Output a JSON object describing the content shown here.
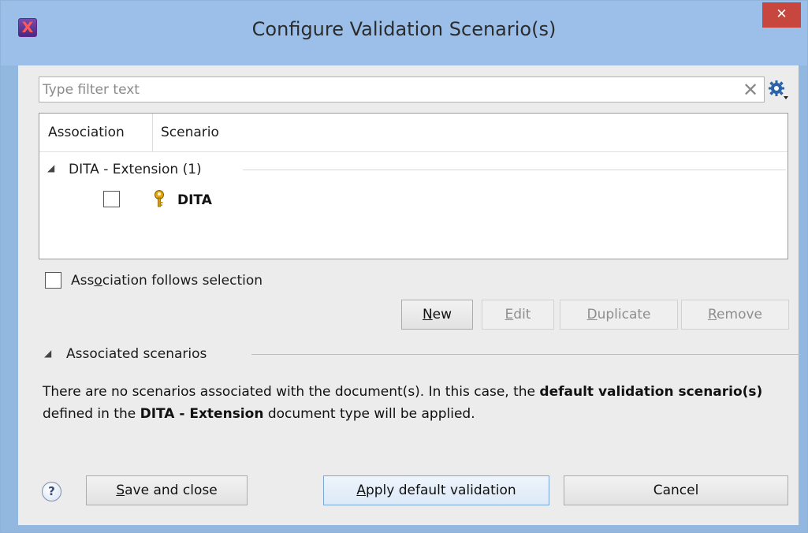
{
  "window": {
    "title": "Configure Validation Scenario(s)",
    "app_icon": "oxygen-x-icon",
    "close_glyph": "✕",
    "accent_color": "#9bbfe8"
  },
  "filter": {
    "placeholder": "Type filter text",
    "value": "",
    "clear_glyph": "✕",
    "settings_icon": "gear-dropdown-icon"
  },
  "table": {
    "columns": [
      "Association",
      "Scenario"
    ],
    "groups": [
      {
        "expanded": true,
        "label": "DITA - Extension (1)",
        "items": [
          {
            "checked": false,
            "icon": "key-icon",
            "name": "DITA"
          }
        ]
      }
    ]
  },
  "association_follows_selection": {
    "checked": false,
    "label_parts": [
      "Ass",
      "o",
      "ciation follows selection"
    ]
  },
  "actions": {
    "new": {
      "mnemonic": "N",
      "rest": "ew",
      "enabled": true
    },
    "edit": {
      "mnemonic": "E",
      "rest": "dit",
      "enabled": false
    },
    "duplicate": {
      "mnemonic": "D",
      "rest": "uplicate",
      "enabled": false
    },
    "remove": {
      "mnemonic": "R",
      "rest": "emove",
      "enabled": false
    }
  },
  "associated_section": {
    "expanded": true,
    "label": "Associated scenarios",
    "message": {
      "part1": "There are no scenarios associated with the document(s). In this case, the ",
      "bold1": "default validation scenario(s)",
      "part2": " defined in the ",
      "bold2": "DITA - Extension",
      "part3": " document type will be applied."
    }
  },
  "footer": {
    "help_glyph": "?",
    "save_close": {
      "mnemonic": "S",
      "rest": "ave and close"
    },
    "apply_default": {
      "mnemonic": "A",
      "rest": "pply default validation"
    },
    "cancel": "Cancel"
  }
}
